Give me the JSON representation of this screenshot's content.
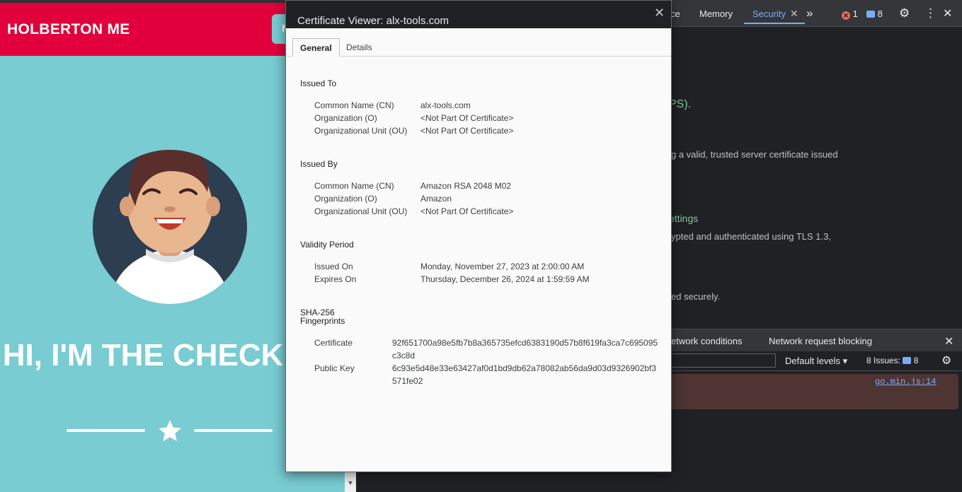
{
  "webpage": {
    "brand": "HOLBERTON ME",
    "nav_button": "M",
    "hero_title": "HI, I'M THE CHECKER!"
  },
  "devtools": {
    "tabs": [
      "ce",
      "Memory",
      "Security"
    ],
    "active_tab": "Security",
    "more_tabs": "»",
    "error_count": "1",
    "message_count": "8",
    "security_lines": {
      "https": "PS).",
      "cert_text": "g a valid, trusted server certificate issued",
      "settings": "ettings",
      "tls_text": "ypted and authenticated using TLS 1.3,",
      "secure_text": "ed securely."
    },
    "drawer_tabs": [
      "etwork conditions",
      "Network request blocking"
    ],
    "levels_label": "Default levels ▾",
    "issues_label": "8 Issues:",
    "issues_count": "8",
    "source_link": "go.min.js:14"
  },
  "cert": {
    "title": "Certificate Viewer: alx-tools.com",
    "tabs": {
      "general": "General",
      "details": "Details"
    },
    "issued_to": {
      "heading": "Issued To",
      "rows": [
        {
          "label": "Common Name (CN)",
          "value": "alx-tools.com"
        },
        {
          "label": "Organization (O)",
          "value": "<Not Part Of Certificate>"
        },
        {
          "label": "Organizational Unit (OU)",
          "value": "<Not Part Of Certificate>"
        }
      ]
    },
    "issued_by": {
      "heading": "Issued By",
      "rows": [
        {
          "label": "Common Name (CN)",
          "value": "Amazon RSA 2048 M02"
        },
        {
          "label": "Organization (O)",
          "value": "Amazon"
        },
        {
          "label": "Organizational Unit (OU)",
          "value": "<Not Part Of Certificate>"
        }
      ]
    },
    "validity": {
      "heading": "Validity Period",
      "rows": [
        {
          "label": "Issued On",
          "value": "Monday, November 27, 2023 at 2:00:00 AM"
        },
        {
          "label": "Expires On",
          "value": "Thursday, December 26, 2024 at 1:59:59 AM"
        }
      ]
    },
    "fingerprints": {
      "heading_line1": "SHA-256",
      "heading_line2": "Fingerprints",
      "rows": [
        {
          "label": "Certificate",
          "value": "92f651700a98e5fb7b8a365735efcd6383190d57b8f619fa3ca7c695095c3c8d"
        },
        {
          "label": "Public Key",
          "value": "6c93e5d48e33e63427af0d1bd9db62a78082ab56da9d03d9326902bf3571fe02"
        }
      ]
    }
  }
}
